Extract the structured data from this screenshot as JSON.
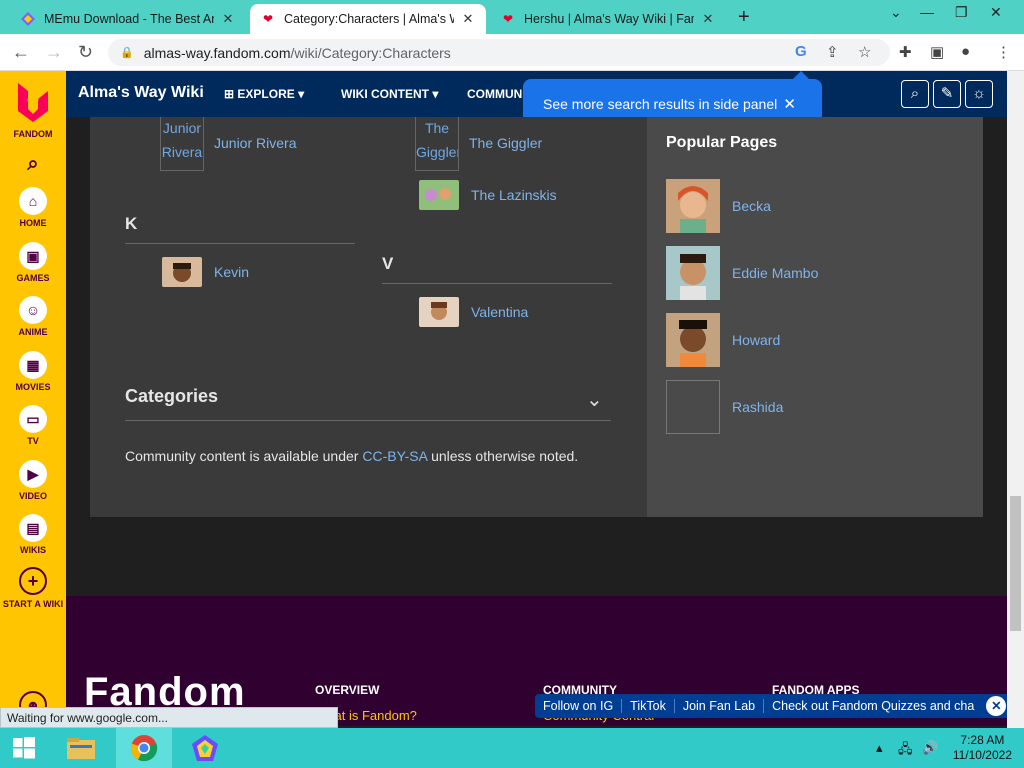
{
  "browser": {
    "tabs": [
      {
        "title": "MEmu Download - The Best And",
        "active": false
      },
      {
        "title": "Category:Characters | Alma's Wa",
        "active": true
      },
      {
        "title": "Hershu | Alma's Way Wiki | Fando",
        "active": false
      }
    ],
    "url_host": "almas-way.fandom.com",
    "url_path": "/wiki/Category:Characters",
    "status": "Waiting for www.google.com..."
  },
  "rail": {
    "logo_label": "FANDOM",
    "items": [
      "HOME",
      "GAMES",
      "ANIME",
      "MOVIES",
      "TV",
      "VIDEO",
      "WIKIS",
      "START A WIKI"
    ]
  },
  "wiki": {
    "name": "Alma's Way Wiki",
    "nav": [
      "EXPLORE",
      "WIKI CONTENT",
      "COMMUNI"
    ]
  },
  "tooltip": {
    "text": "See more search results in side panel"
  },
  "characters": {
    "col1": [
      {
        "name": "Junior Rivera",
        "broken_alt": "Junior Rivera"
      },
      {
        "letter": "K"
      },
      {
        "name": "Kevin"
      }
    ],
    "col2": [
      {
        "name": "The Giggler",
        "broken_alt": "The Giggler"
      },
      {
        "name": "The Lazinskis"
      },
      {
        "letter": "V"
      },
      {
        "name": "Valentina"
      }
    ]
  },
  "categories_label": "Categories",
  "license": {
    "before": "Community content is available under ",
    "link": "CC-BY-SA",
    "after": " unless otherwise noted."
  },
  "popular": {
    "title": "Popular Pages",
    "items": [
      "Becka",
      "Eddie Mambo",
      "Howard",
      "Rashida"
    ]
  },
  "footer": {
    "logo": "Fandom",
    "headers": [
      "OVERVIEW",
      "COMMUNITY",
      "FANDOM APPS"
    ],
    "overview_link": "What is Fandom?",
    "community_link": "Community Central"
  },
  "promo": [
    "Follow on IG",
    "TikTok",
    "Join Fan Lab",
    "Check out Fandom Quizzes and cha"
  ],
  "taskbar": {
    "time": "7:28 AM",
    "date": "11/10/2022"
  }
}
